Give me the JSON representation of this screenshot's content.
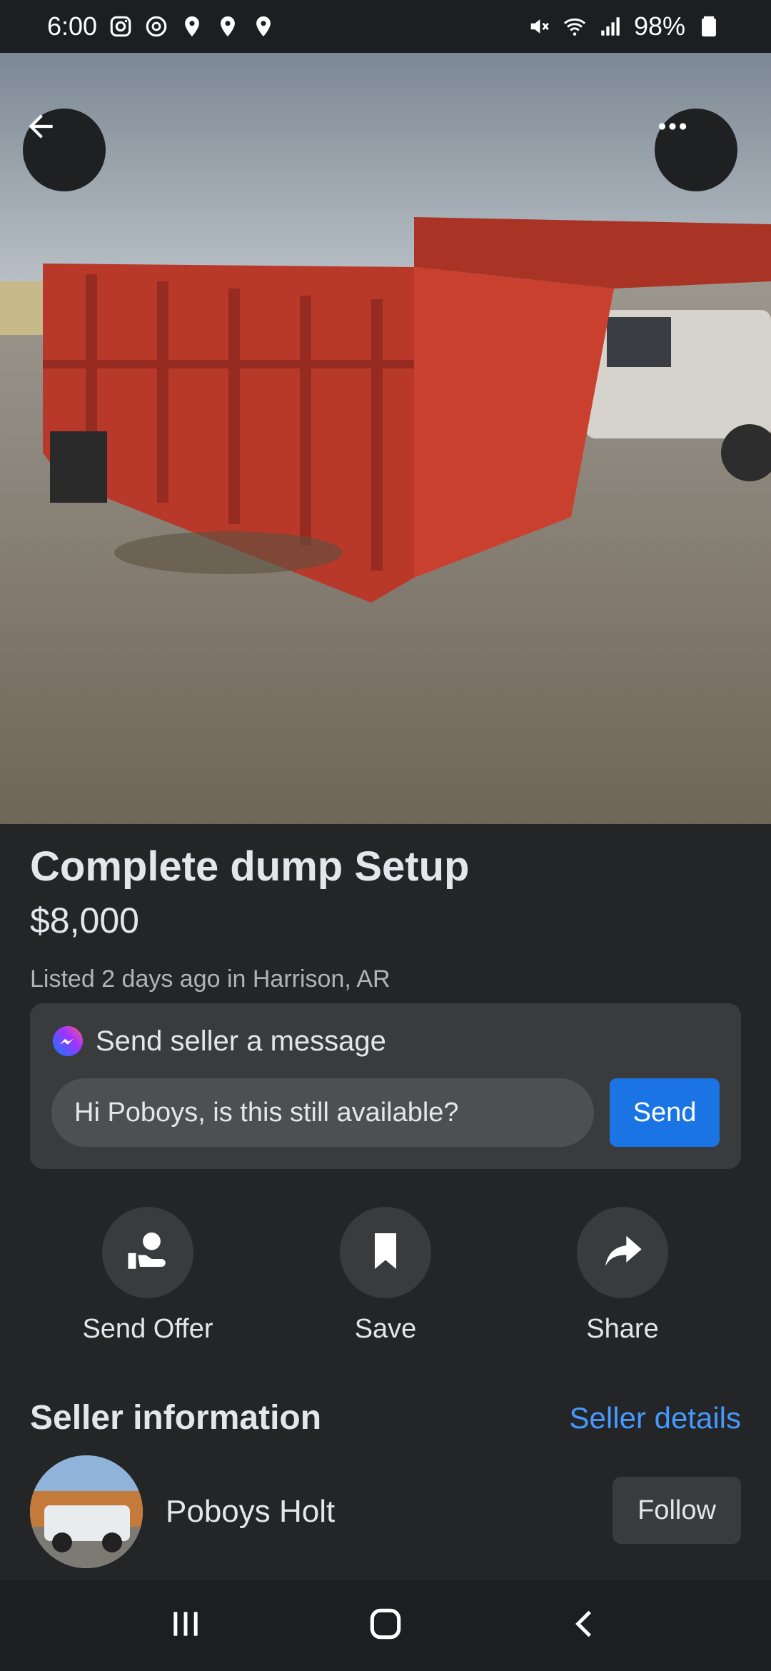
{
  "status_bar": {
    "time": "6:00",
    "battery": "98%",
    "left_icons": [
      "instagram-icon",
      "sync-icon",
      "location-pin-icon",
      "location-pin-icon",
      "location-pin-icon"
    ],
    "right_icons": [
      "mute-icon",
      "wifi-icon",
      "signal-icon",
      "battery-icon"
    ]
  },
  "photo": {
    "image_count": 5,
    "active_index": 2
  },
  "listing": {
    "title": "Complete dump Setup",
    "price": "$8,000",
    "meta": "Listed 2 days ago in Harrison, AR"
  },
  "message": {
    "header": "Send seller a message",
    "input_value": "Hi Poboys, is this still available?",
    "send_label": "Send"
  },
  "actions": [
    {
      "label": "Send Offer",
      "icon": "offer-icon"
    },
    {
      "label": "Save",
      "icon": "bookmark-icon"
    },
    {
      "label": "Share",
      "icon": "share-icon"
    }
  ],
  "seller": {
    "heading": "Seller information",
    "details_link": "Seller details",
    "name": "Poboys Holt",
    "follow_label": "Follow"
  },
  "colors": {
    "background": "#242526",
    "accent": "#1b74e4",
    "link": "#4599ff",
    "card": "#3a3b3c"
  }
}
